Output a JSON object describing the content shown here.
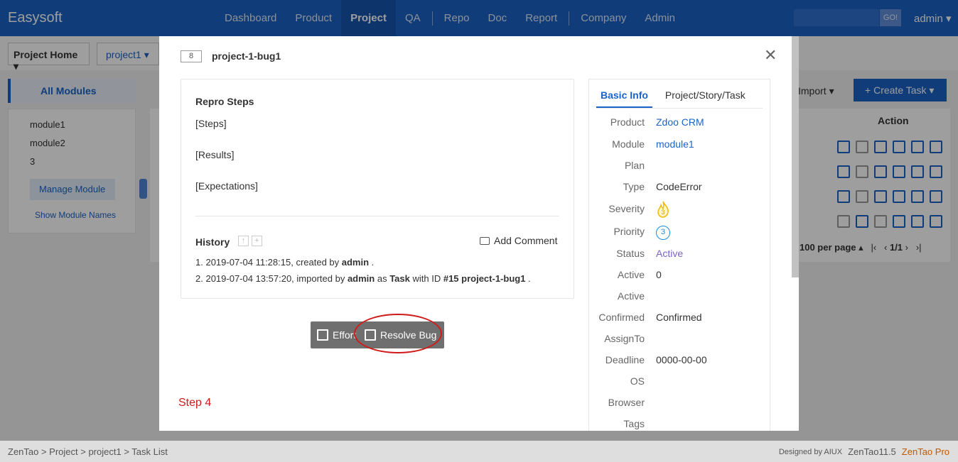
{
  "topnav": {
    "brand": "Easysoft",
    "items": [
      "Dashboard",
      "Product",
      "Project",
      "QA",
      "Repo",
      "Doc",
      "Report",
      "Company",
      "Admin"
    ],
    "active": "Project",
    "search_go": "GO!",
    "user": "admin"
  },
  "background": {
    "crumb_home": "Project Home",
    "crumb_project": "project1",
    "all_modules": "All Modules",
    "modules": [
      "module1",
      "module2",
      "3"
    ],
    "manage_module": "Manage Module",
    "show_module_names": "Show Module Names",
    "import": "Import",
    "create_task": "Create Task",
    "action_header": "Action",
    "pager": "100 per page",
    "page": "1/1"
  },
  "modal": {
    "id": "8",
    "title": "project-1-bug1",
    "repro_title": "Repro Steps",
    "steps": "[Steps]",
    "results": "[Results]",
    "expectations": "[Expectations]",
    "history_title": "History",
    "add_comment": "Add Comment",
    "history": [
      {
        "num": "1.",
        "text": "2019-07-04 11:28:15, created by ",
        "who": "admin",
        "tail": " ."
      },
      {
        "num": "2.",
        "text": "2019-07-04 13:57:20, imported by ",
        "who": "admin",
        "mid": " as ",
        "obj": "Task",
        "mid2": " with ID ",
        "ref": "#15 project-1-bug1",
        "tail": " ."
      }
    ],
    "effort_label": "Effort",
    "resolve_label": "Resolve Bug",
    "step_note": "Step 4",
    "tabs": [
      "Basic Info",
      "Project/Story/Task"
    ],
    "fields": [
      {
        "label": "Product",
        "value": "Zdoo CRM"
      },
      {
        "label": "Module",
        "value": "module1"
      },
      {
        "label": "Plan",
        "value": ""
      },
      {
        "label": "Type",
        "value": "CodeError"
      },
      {
        "label": "Severity",
        "value": "3"
      },
      {
        "label": "Priority",
        "value": "3"
      },
      {
        "label": "Status",
        "value": "Active"
      },
      {
        "label": "Active",
        "value": "0"
      },
      {
        "label": "Active",
        "value": ""
      },
      {
        "label": "Confirmed",
        "value": "Confirmed"
      },
      {
        "label": "AssignTo",
        "value": ""
      },
      {
        "label": "Deadline",
        "value": "0000-00-00"
      },
      {
        "label": "OS",
        "value": ""
      },
      {
        "label": "Browser",
        "value": ""
      },
      {
        "label": "Tags",
        "value": ""
      }
    ]
  },
  "footer": {
    "breadcrumb": "ZenTao > Project > project1 > Task List",
    "designed_by": "Designed by AIUX",
    "version": "ZenTao11.5",
    "pro": "ZenTao Pro"
  },
  "colors": {
    "primary": "#1b63c6",
    "annotation": "#d11a1a",
    "status_active": "#7a62c6"
  }
}
